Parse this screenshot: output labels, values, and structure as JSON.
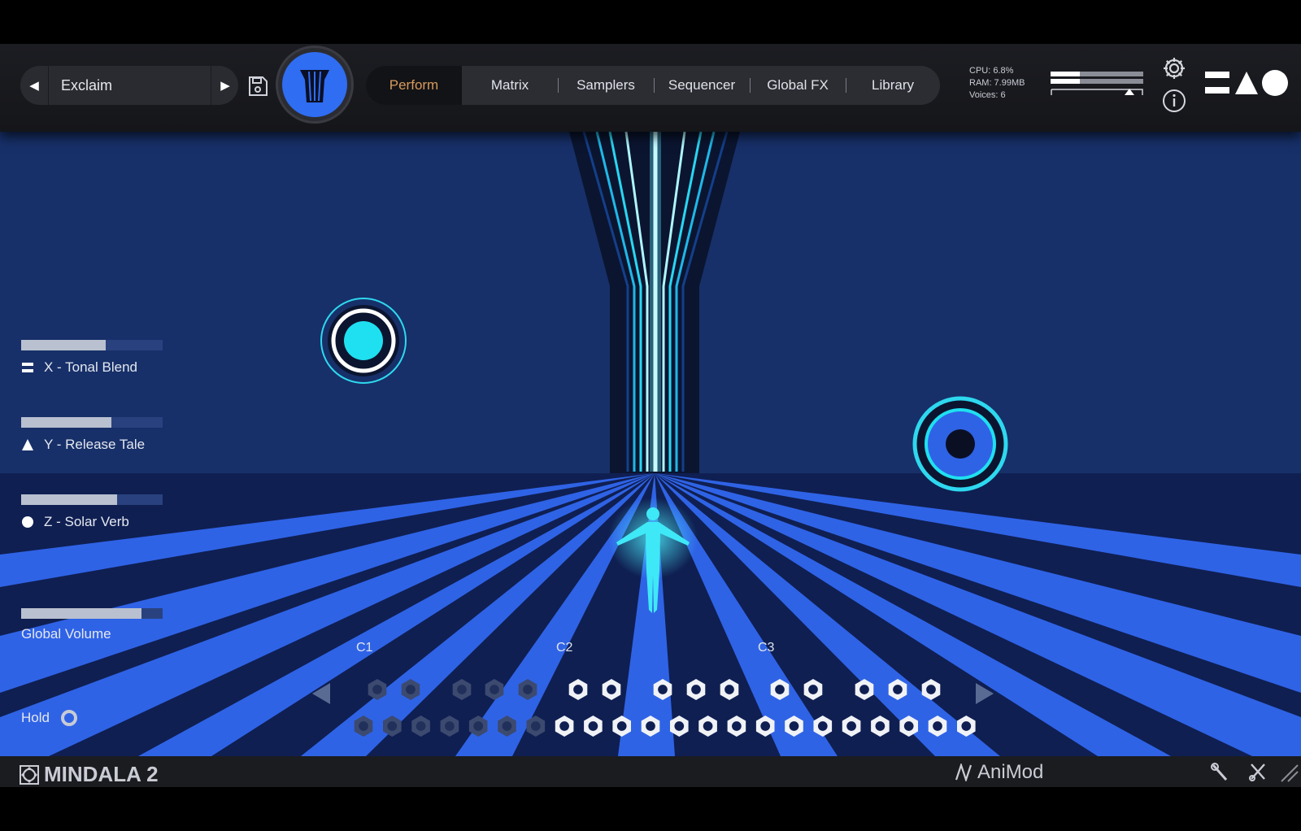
{
  "header": {
    "preset_name": "Exclaim",
    "tabs": [
      {
        "label": "Perform",
        "active": true
      },
      {
        "label": "Matrix",
        "active": false
      },
      {
        "label": "Samplers",
        "active": false
      },
      {
        "label": "Sequencer",
        "active": false
      },
      {
        "label": "Global FX",
        "active": false
      },
      {
        "label": "Library",
        "active": false
      }
    ],
    "stats": {
      "cpu": "CPU: 6.8%",
      "ram": "RAM: 7.99MB",
      "voices": "Voices: 6"
    },
    "output_meter_level": 0.32,
    "icons": [
      "chevron-left-icon",
      "play-icon",
      "save-icon",
      "gear-icon",
      "info-icon"
    ]
  },
  "macros": [
    {
      "label": "X - Tonal Blend",
      "level": 0.6,
      "symbol": "equals"
    },
    {
      "label": "Y - Release Tale",
      "level": 0.64,
      "symbol": "triangle"
    },
    {
      "label": "Z - Solar Verb",
      "level": 0.68,
      "symbol": "circle"
    }
  ],
  "global_volume": {
    "label": "Global Volume",
    "level": 0.85
  },
  "hold": {
    "label": "Hold"
  },
  "keyboard": {
    "octave_labels": [
      "C1",
      "C2",
      "C3"
    ],
    "top_row_active": [
      false,
      false,
      false,
      false,
      false,
      true,
      true,
      true,
      true,
      true,
      true,
      true,
      true,
      true,
      true
    ],
    "bottom_row_active": [
      false,
      false,
      false,
      false,
      false,
      false,
      false,
      true,
      true,
      true,
      true,
      true,
      true,
      true,
      true,
      true,
      true,
      true,
      true,
      true,
      true,
      true
    ]
  },
  "footer": {
    "brand": "MINDALA 2",
    "animod": "AniMod"
  },
  "colors": {
    "accent_tab": "#d89a5c",
    "stage_bg": "#173069",
    "beam": "#2f63e6",
    "cyan": "#1fe0f0"
  }
}
